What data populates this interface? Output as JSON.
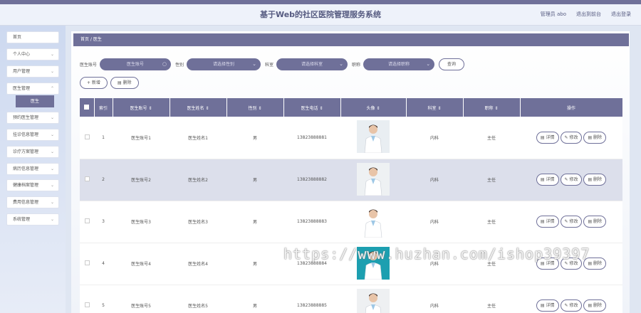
{
  "header": {
    "title": "基于Web的社区医院管理服务系统",
    "admin": "管理员 abo",
    "back_home": "退出到前台",
    "logout": "退出登录"
  },
  "sidebar": {
    "items": [
      {
        "label": "首页",
        "chevron": false
      },
      {
        "label": "个人中心",
        "chevron": true
      },
      {
        "label": "用户管理",
        "chevron": true
      },
      {
        "label": "医生管理",
        "chevron": true
      },
      {
        "label": "预约医生管理",
        "chevron": true
      },
      {
        "label": "挂诊信息管理",
        "chevron": true
      },
      {
        "label": "诊疗方案管理",
        "chevron": true
      },
      {
        "label": "病历信息管理",
        "chevron": true
      },
      {
        "label": "健康档案管理",
        "chevron": true
      },
      {
        "label": "费用信息管理",
        "chevron": true
      },
      {
        "label": "系统管理",
        "chevron": true
      }
    ],
    "active_sub": "医生"
  },
  "breadcrumb": "首页 / 医生",
  "search": {
    "account_label": "医生账号",
    "account_placeholder": "医生账号",
    "gender_label": "性别",
    "gender_placeholder": "请选择性别",
    "dept_label": "科室",
    "dept_placeholder": "请选择科室",
    "title_label": "职称",
    "title_placeholder": "请选择职称",
    "query": "查询"
  },
  "actions": {
    "add": "+ 新增",
    "delete": "删除"
  },
  "table": {
    "headers": [
      "索引",
      "医生账号 ⇕",
      "医生姓名 ⇕",
      "性别 ⇕",
      "医生电话 ⇕",
      "头像 ⇕",
      "科室 ⇕",
      "职称 ⇕",
      "操作"
    ],
    "rows": [
      {
        "index": "1",
        "account": "医生账号1",
        "name": "医生姓名1",
        "gender": "男",
        "phone": "13823888881",
        "dept": "内科",
        "title": "主任"
      },
      {
        "index": "2",
        "account": "医生账号2",
        "name": "医生姓名2",
        "gender": "男",
        "phone": "13823888882",
        "dept": "内科",
        "title": "主任"
      },
      {
        "index": "3",
        "account": "医生账号3",
        "name": "医生姓名3",
        "gender": "男",
        "phone": "13823888883",
        "dept": "内科",
        "title": "主任"
      },
      {
        "index": "4",
        "account": "医生账号4",
        "name": "医生姓名4",
        "gender": "男",
        "phone": "13823888884",
        "dept": "内科",
        "title": "主任"
      },
      {
        "index": "5",
        "account": "医生账号5",
        "name": "医生姓名5",
        "gender": "男",
        "phone": "13823888885",
        "dept": "内科",
        "title": "主任"
      }
    ],
    "op_detail": "详情",
    "op_edit": "修改",
    "op_delete": "删除"
  },
  "watermark": "https://www.huzhan.com/ishop39397"
}
